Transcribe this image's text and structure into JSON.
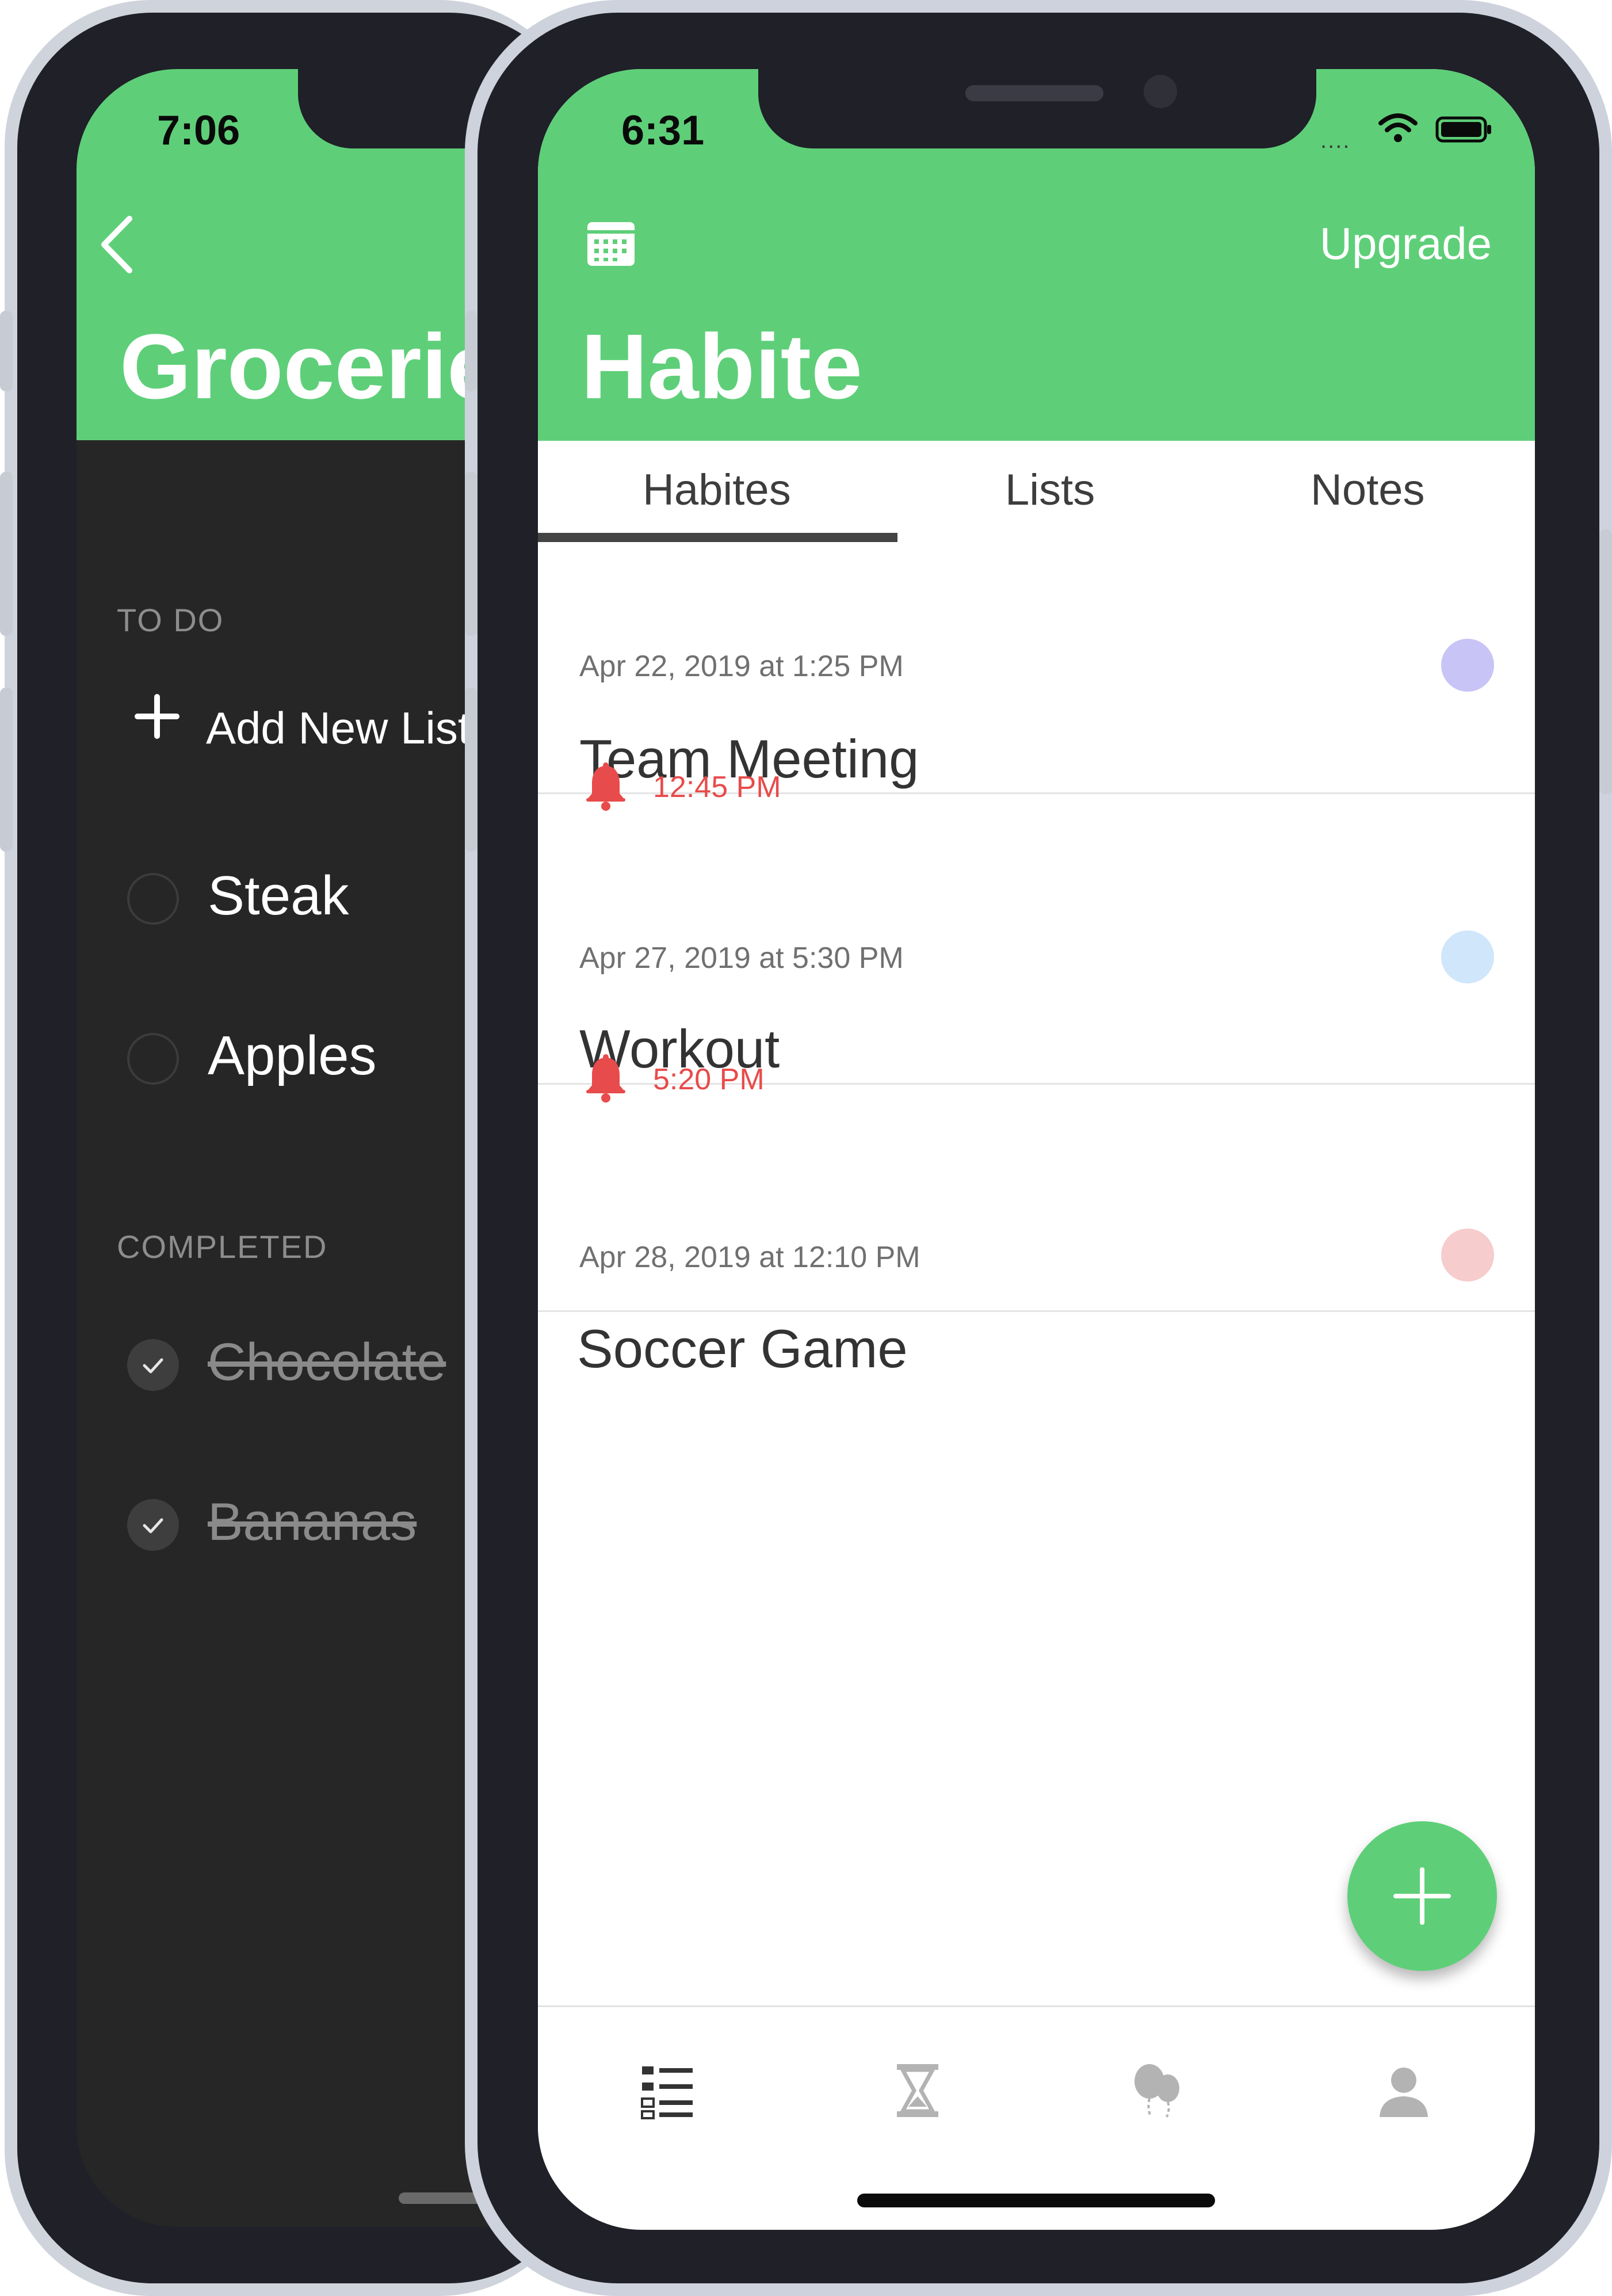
{
  "back_phone": {
    "status_time": "7:06",
    "title": "Grocerie",
    "sections": {
      "todo": "TO DO",
      "completed": "COMPLETED"
    },
    "add_new_list": "Add New List",
    "todo_items": [
      "Steak",
      "Apples"
    ],
    "completed_items": [
      "Chocolate",
      "Bananas"
    ]
  },
  "front_phone": {
    "status_time": "6:31",
    "signal": "....",
    "header": {
      "upgrade_label": "Upgrade",
      "title": "Habite"
    },
    "tabs": [
      {
        "label": "Habites",
        "active": true
      },
      {
        "label": "Lists",
        "active": false
      },
      {
        "label": "Notes",
        "active": false
      }
    ],
    "habits": [
      {
        "date": "Apr 22, 2019 at 1:25 PM",
        "title": "Team Meeting",
        "reminder": "12:45 PM",
        "color": "#c9c4f6"
      },
      {
        "date": "Apr 27, 2019 at 5:30 PM",
        "title": "Workout",
        "reminder": "5:20 PM",
        "color": "#cfe6fb"
      },
      {
        "date": "Apr 28, 2019 at 12:10 PM",
        "title": "Soccer Game",
        "reminder": "",
        "color": "#f6cccc"
      }
    ],
    "tabbar_icons": [
      "list-icon",
      "hourglass-icon",
      "balloons-icon",
      "user-icon"
    ]
  },
  "colors": {
    "accent_green": "#5ecf78",
    "reminder_red": "#e84b4b",
    "dark_background": "#262626"
  }
}
